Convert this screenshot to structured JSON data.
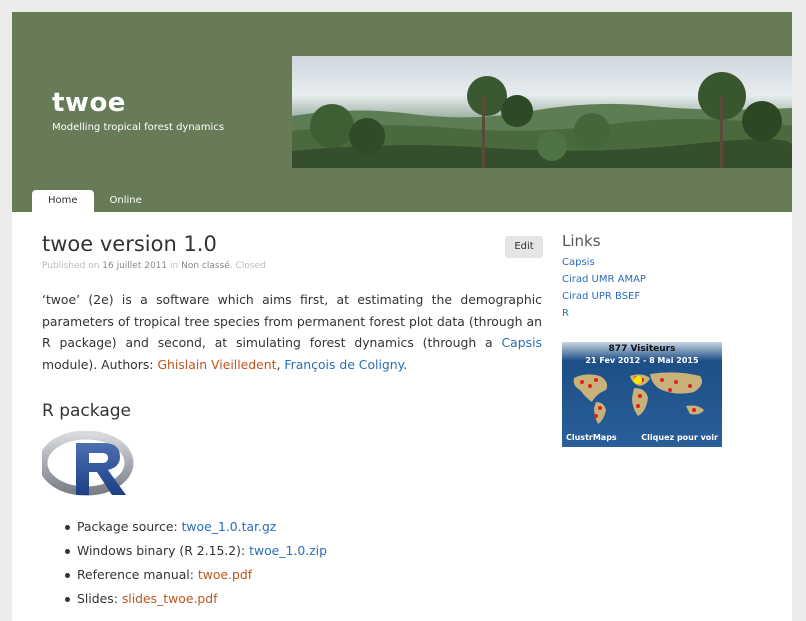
{
  "site": {
    "title": "twoe",
    "description": "Modelling tropical forest dynamics"
  },
  "nav": [
    {
      "label": "Home",
      "active": true
    },
    {
      "label": "Online",
      "active": false
    }
  ],
  "post": {
    "title": "twoe version 1.0",
    "edit_label": "Edit",
    "meta": {
      "published_on": "Published on",
      "date": "16 juillet 2011",
      "in": "in",
      "category": "Non classé",
      "status": "Closed"
    },
    "intro": {
      "part1": "‘twoe’ (2e) is a software which aims first, at estimating the demographic parameters of tropical tree species from permanent forest plot data (through an R package) and second, at simulating forest dynamics (through a ",
      "capsis_link": "Capsis",
      "part2": " module). Authors: ",
      "author1": "Ghislain Vieilledent",
      "sep": ", ",
      "author2": "François de Coligny",
      "end": "."
    },
    "r_heading": "R package",
    "downloads": [
      {
        "label": "Package source: ",
        "link": "twoe_1.0.tar.gz",
        "color": "blue"
      },
      {
        "label": "Windows binary (R 2.15.2): ",
        "link": "twoe_1.0.zip",
        "color": "blue"
      },
      {
        "label": "Reference manual: ",
        "link": "twoe.pdf",
        "color": "orange"
      },
      {
        "label": "Slides: ",
        "link": "slides_twoe.pdf",
        "color": "orange"
      }
    ]
  },
  "sidebar": {
    "links_title": "Links",
    "links": [
      "Capsis",
      "Cirad UMR AMAP",
      "Cirad UPR BSEF",
      "R"
    ],
    "clustrmaps": {
      "visitors": "877",
      "visitors_label": "Visiteurs",
      "date_range": "21 Fev 2012 - 8 Mai 2015",
      "brand": "ClustrMaps",
      "cta": "Cliquez pour voir"
    }
  },
  "colors": {
    "header_bg": "#687b57",
    "link_blue": "#2a6ebb",
    "link_orange": "#c0561f"
  }
}
